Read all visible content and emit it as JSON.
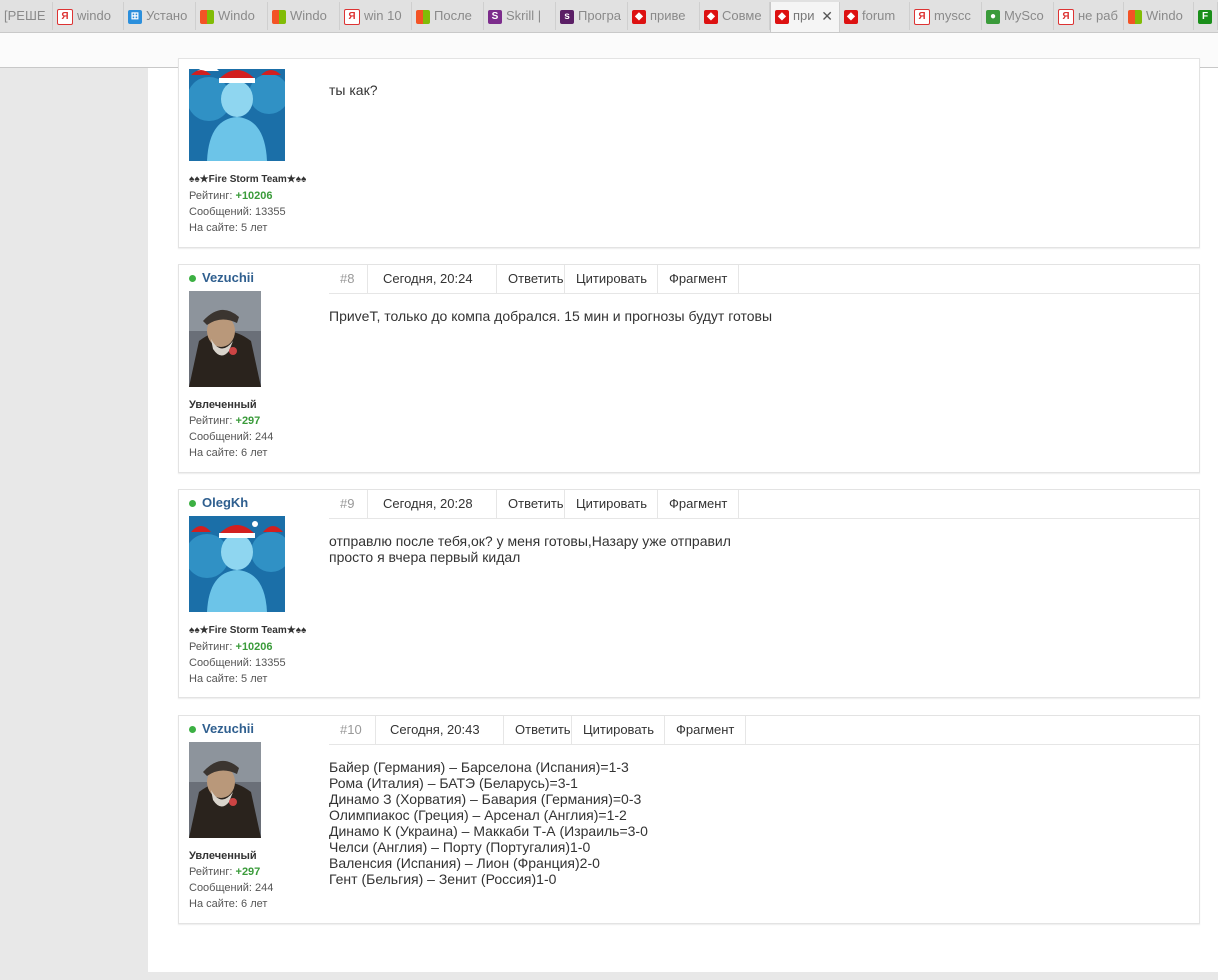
{
  "browser": {
    "tabs": [
      {
        "label": "[РЕШЕ",
        "icon": "none"
      },
      {
        "label": "windo",
        "icon": "yandex"
      },
      {
        "label": "Устано",
        "icon": "windows"
      },
      {
        "label": "Windo",
        "icon": "microsoft"
      },
      {
        "label": "Windo",
        "icon": "microsoft"
      },
      {
        "label": "win 10",
        "icon": "yandex"
      },
      {
        "label": "После",
        "icon": "microsoft"
      },
      {
        "label": "Skrill |",
        "icon": "skrill"
      },
      {
        "label": "Програ",
        "icon": "skrill-dark"
      },
      {
        "label": "приве",
        "icon": "forum"
      },
      {
        "label": "Совме",
        "icon": "forum"
      },
      {
        "label": "при",
        "icon": "forum"
      },
      {
        "label": "forum",
        "icon": "forum"
      },
      {
        "label": "myscc",
        "icon": "yandex"
      },
      {
        "label": "MySco",
        "icon": "green"
      },
      {
        "label": "не раб",
        "icon": "yandex"
      },
      {
        "label": "Windo",
        "icon": "microsoft"
      },
      {
        "label": "F",
        "icon": "green-f"
      }
    ],
    "active_close": "✕"
  },
  "posts": [
    {
      "rank": "♠♠★Fire Storm Team★♠♠",
      "rating_label": "Рейтинг:",
      "rating": "+10206",
      "messages": "Сообщений: 13355",
      "online": "На сайте: 5 лет",
      "text": "ты как?",
      "avatar": "ice-warrior"
    },
    {
      "username": "Vezuchii",
      "number": "#8",
      "date": "Сегодня, 20:24",
      "reply": "Ответить",
      "quote": "Цитировать",
      "fragment": "Фрагмент",
      "rank": "Увлеченный",
      "rating_label": "Рейтинг:",
      "rating": "+297",
      "messages": "Сообщений: 244",
      "online": "На сайте: 6 лет",
      "text": "ПриveT, только до компа добрался. 15 мин и прогнозы будут готовы",
      "avatar": "old-man"
    },
    {
      "username": "OlegKh",
      "number": "#9",
      "date": "Сегодня, 20:28",
      "reply": "Ответить",
      "quote": "Цитировать",
      "fragment": "Фрагмент",
      "rank": "♠♠★Fire Storm Team★♠♠",
      "rating_label": "Рейтинг:",
      "rating": "+10206",
      "messages": "Сообщений: 13355",
      "online": "На сайте: 5 лет",
      "text": "отправлю после тебя,ок? у меня готовы,Назару уже отправил\nпросто я вчера первый кидал",
      "avatar": "ice-warrior"
    },
    {
      "username": "Vezuchii",
      "number": "#10",
      "date": "Сегодня, 20:43",
      "reply": "Ответить",
      "quote": "Цитировать",
      "fragment": "Фрагмент",
      "rank": "Увлеченный",
      "rating_label": "Рейтинг:",
      "rating": "+297",
      "messages": "Сообщений: 244",
      "online": "На сайте: 6 лет",
      "text": "Байер (Германия) – Барселона (Испания)=1-3\nРома (Италия) – БАТЭ (Беларусь)=3-1\nДинамо З (Хорватия) – Бавария (Германия)=0-3\nОлимпиакос (Греция) – Арсенал (Англия)=1-2\nДинамо К (Украина) – Маккаби Т-А (Израиль=3-0\nЧелси (Англия) – Порту (Португалия)1-0\nВаленсия (Испания) – Лион (Франция)2-0\nГент (Бельгия) – Зенит (Россия)1-0",
      "avatar": "old-man"
    }
  ],
  "colors": {
    "username": "#2f5f8f",
    "rating": "#3a9b3a",
    "online_dot": "#3cb043"
  }
}
